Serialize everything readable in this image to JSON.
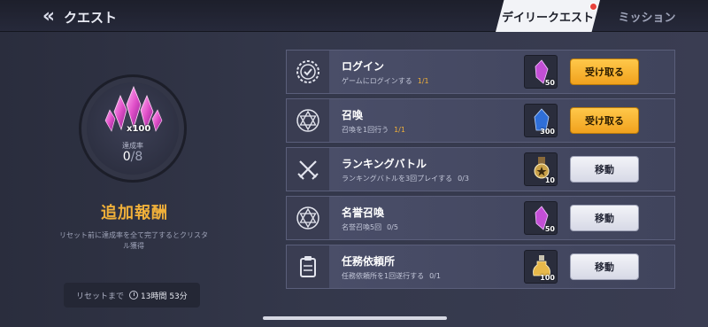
{
  "header": {
    "title": "クエスト"
  },
  "tabs": [
    {
      "label": "デイリークエスト",
      "active": true,
      "notification": true
    },
    {
      "label": "ミッション",
      "active": false
    }
  ],
  "summary": {
    "crystal_amount": "x100",
    "rate_label": "達成率",
    "rate_done": "0",
    "rate_total": "/8",
    "bonus_title": "追加報酬",
    "bonus_desc": "リセット前に達成率を全て完了するとクリスタル獲得",
    "reset_label": "リセットまで",
    "reset_time": "13時間 53分"
  },
  "quests": [
    {
      "name": "ログイン",
      "desc": "ゲームにログインする",
      "progress": "1/1",
      "done": true,
      "icon": "login-badge-icon",
      "reward_icon": "purple-crystal-icon",
      "reward_count": "50",
      "button": "受け取る",
      "button_type": "claim"
    },
    {
      "name": "召喚",
      "desc": "召喚を1回行う",
      "progress": "1/1",
      "done": true,
      "icon": "summon-hexagram-icon",
      "reward_icon": "blue-crystal-icon",
      "reward_count": "300",
      "button": "受け取る",
      "button_type": "claim"
    },
    {
      "name": "ランキングバトル",
      "desc": "ランキングバトルを3回プレイする",
      "progress": "0/3",
      "done": false,
      "icon": "crossed-swords-icon",
      "reward_icon": "medal-icon",
      "reward_count": "10",
      "button": "移動",
      "button_type": "move"
    },
    {
      "name": "名誉召喚",
      "desc": "名誉召喚5回",
      "progress": "0/5",
      "done": false,
      "icon": "summon-hexagram-icon",
      "reward_icon": "purple-crystal-icon",
      "reward_count": "50",
      "button": "移動",
      "button_type": "move"
    },
    {
      "name": "任務依頼所",
      "desc": "任務依頼所を1回遂行する",
      "progress": "0/1",
      "done": false,
      "icon": "clipboard-icon",
      "reward_icon": "potion-icon",
      "reward_count": "100",
      "button": "移動",
      "button_type": "move"
    }
  ],
  "colors": {
    "accent_gold": "#f0b03a",
    "claim_button": "#f1a21e",
    "move_button": "#e6e8f2"
  }
}
